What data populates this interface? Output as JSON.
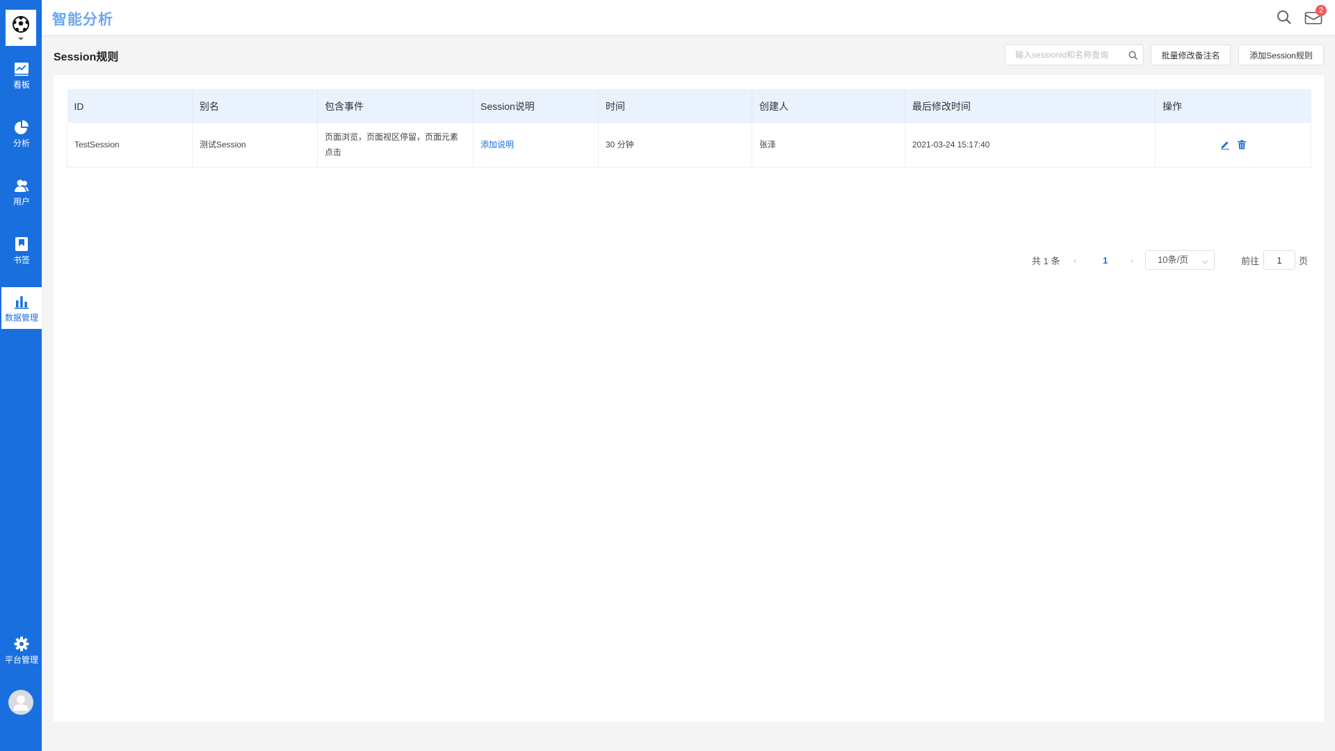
{
  "header": {
    "app_title": "智能分析",
    "mail_badge": "2"
  },
  "sidebar": {
    "items": [
      {
        "label": "看板",
        "icon": "dashboard-icon"
      },
      {
        "label": "分析",
        "icon": "pie-chart-icon"
      },
      {
        "label": "用户",
        "icon": "users-icon"
      },
      {
        "label": "书签",
        "icon": "bookmark-icon"
      },
      {
        "label": "数据管理",
        "icon": "bar-chart-icon",
        "active": true
      },
      {
        "label": "平台管理",
        "icon": "gear-icon"
      }
    ]
  },
  "page": {
    "title": "Session规则",
    "search_placeholder": "输入sessionid和名称查询",
    "batch_button": "批量修改备注名",
    "add_button": "添加Session规则"
  },
  "table": {
    "columns": [
      "ID",
      "别名",
      "包含事件",
      "Session说明",
      "时间",
      "创建人",
      "最后修改时间",
      "操作"
    ],
    "rows": [
      {
        "id": "TestSession",
        "alias": "测试Session",
        "events": "页面浏览，页面视区停留，页面元素点击",
        "description_link": "添加说明",
        "duration": "30 分钟",
        "creator": "张泽",
        "modified": "2021-03-24 15:17:40"
      }
    ]
  },
  "pagination": {
    "total_text": "共 1 条",
    "current_page": "1",
    "page_size": "10条/页",
    "goto_label": "前往",
    "goto_value": "1",
    "page_suffix": "页"
  },
  "colors": {
    "brand": "#1a6fde",
    "title": "#6aa7f0",
    "header_row": "#eaf2fe",
    "badge": "#f25b5b"
  }
}
